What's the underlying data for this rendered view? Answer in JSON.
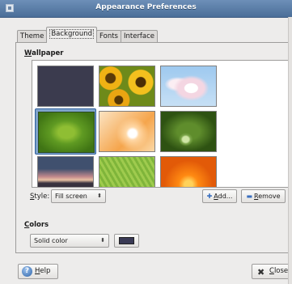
{
  "window": {
    "title": "Appearance Preferences"
  },
  "tabs": [
    {
      "label": "Theme",
      "active": false
    },
    {
      "label": "Background",
      "active": true
    },
    {
      "label": "Fonts",
      "active": false
    },
    {
      "label": "Interface",
      "active": false
    }
  ],
  "wallpaper": {
    "heading_mnemonic": "W",
    "heading_rest": "allpaper",
    "thumbnails": [
      {
        "name": "dark-slate",
        "selected": false
      },
      {
        "name": "sunflowers",
        "selected": false
      },
      {
        "name": "cherry-blossom",
        "selected": false
      },
      {
        "name": "green-leaf",
        "selected": true
      },
      {
        "name": "orange-petals",
        "selected": false
      },
      {
        "name": "dew-drop",
        "selected": false
      },
      {
        "name": "sunset-sky",
        "selected": false
      },
      {
        "name": "leaf-texture",
        "selected": false
      },
      {
        "name": "orange-flower",
        "selected": false
      }
    ],
    "style_label_mnemonic": "S",
    "style_label_rest": "tyle:",
    "style_value": "Fill screen",
    "add_button_mnemonic": "A",
    "add_button_rest": "dd...",
    "remove_button_mnemonic": "R",
    "remove_button_rest": "emove"
  },
  "colors": {
    "heading_mnemonic": "C",
    "heading_rest": "olors",
    "mode_value": "Solid color",
    "swatch_color": "#3a3a55"
  },
  "footer": {
    "help_mnemonic": "H",
    "help_rest": "elp",
    "close_mnemonic": "C",
    "close_rest": "lose"
  }
}
